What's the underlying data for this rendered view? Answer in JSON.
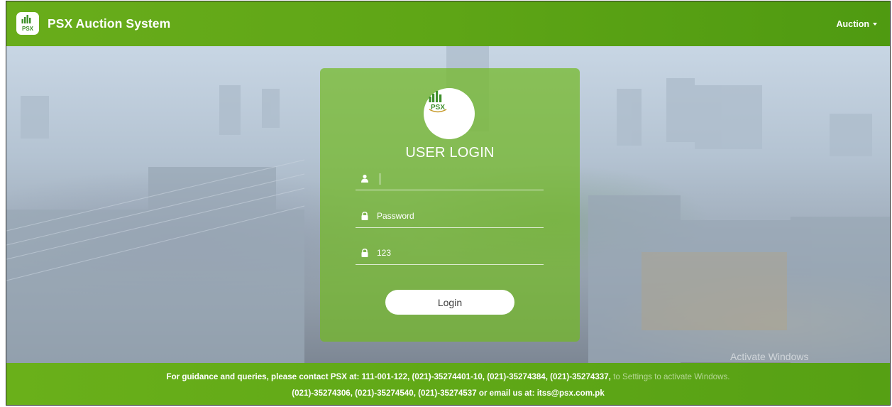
{
  "navbar": {
    "logo_text": "PSX",
    "title": "PSX Auction System",
    "menu_label": "Auction"
  },
  "login": {
    "logo_text": "PSX",
    "heading": "USER LOGIN",
    "username_value": "",
    "password_placeholder": "Password",
    "captcha_value": "123",
    "button_label": "Login"
  },
  "watermark": {
    "title": "Activate Windows",
    "subtitle": "to Settings to activate Windows."
  },
  "footer": {
    "line1": "For guidance and queries, please contact PSX at: 111-001-122, (021)-35274401-10, (021)-35274384, (021)-35274337,",
    "line2": "(021)-35274306, (021)-35274540, (021)-35274537 or email us at: itss@psx.com.pk"
  },
  "colors": {
    "brand_green": "#5ea516",
    "card_green": "#72b923"
  },
  "icons": [
    "psx-logo-icon",
    "caret-down-icon",
    "user-icon",
    "lock-icon"
  ]
}
